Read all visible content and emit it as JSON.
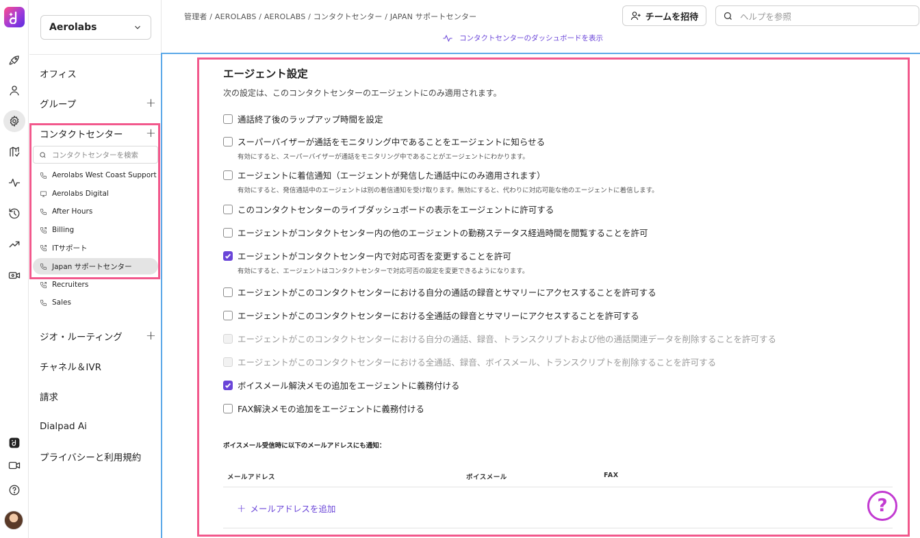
{
  "sidebar": {
    "org": "Aerolabs",
    "nav": {
      "office": "オフィス",
      "groups": "グループ",
      "contact_centers": "コンタクトセンター",
      "geo_routing": "ジオ・ルーティング",
      "channels_ivr": "チャネル＆IVR",
      "billing": "請求",
      "dialpad_ai": "Dialpad Ai",
      "privacy": "プライバシーと利用規約"
    },
    "cc_search_placeholder": "コンタクトセンターを検索",
    "contact_centers": [
      {
        "label": "Aerolabs West Coast Support",
        "icon": "phone-icon"
      },
      {
        "label": "Aerolabs Digital",
        "icon": "monitor-icon"
      },
      {
        "label": "After Hours",
        "icon": "phone-icon"
      },
      {
        "label": "Billing",
        "icon": "phone-forward-icon"
      },
      {
        "label": "ITサポート",
        "icon": "phone-forward-icon"
      },
      {
        "label": "Japan サポートセンター",
        "icon": "phone-icon",
        "selected": true
      },
      {
        "label": "Recruiters",
        "icon": "phone-forward-icon"
      },
      {
        "label": "Sales",
        "icon": "phone-icon"
      }
    ]
  },
  "header": {
    "breadcrumb": "管理者 / AEROLABS / AEROLABS / コンタクトセンター / JAPAN サポートセンター",
    "dashboard_link": "コンタクトセンターのダッシュボードを表示",
    "invite_button": "チームを招待",
    "help_search_placeholder": "ヘルプを参照"
  },
  "agent_settings": {
    "title": "エージェント設定",
    "description": "次の設定は、このコンタクトセンターのエージェントにのみ適用されます。",
    "items": [
      {
        "label": "通話終了後のラップアップ時間を設定",
        "checked": false,
        "disabled": false
      },
      {
        "label": "スーパーバイザーが通話をモニタリング中であることをエージェントに知らせる",
        "sub": "有効にすると、スーパーバイザーが通話をモニタリング中であることがエージェントにわかります。",
        "checked": false,
        "disabled": false
      },
      {
        "label": "エージェントに着信通知（エージェントが発信した通話中にのみ適用されます）",
        "sub": "有効にすると、発信通話中のエージェントは別の着信通知を受け取ります。無効にすると、代わりに対応可能な他のエージェントに着信します。",
        "checked": false,
        "disabled": false
      },
      {
        "label": "このコンタクトセンターのライブダッシュボードの表示をエージェントに許可する",
        "checked": false,
        "disabled": false
      },
      {
        "label": "エージェントがコンタクトセンター内の他のエージェントの勤務ステータス経過時間を閲覧することを許可",
        "checked": false,
        "disabled": false
      },
      {
        "label": "エージェントがコンタクトセンター内で対応可否を変更することを許可",
        "sub": "有効にすると、エージェントはコンタクトセンターで対応可否の設定を変更できるようになります。",
        "checked": true,
        "disabled": false
      },
      {
        "label": "エージェントがこのコンタクトセンターにおける自分の通話の録音とサマリーにアクセスすることを許可する",
        "checked": false,
        "disabled": false
      },
      {
        "label": "エージェントがこのコンタクトセンターにおける全通話の録音とサマリーにアクセスすることを許可する",
        "checked": false,
        "disabled": false
      },
      {
        "label": "エージェントがこのコンタクトセンターにおける自分の通話、録音、トランスクリプトおよび他の通話関連データを削除することを許可する",
        "checked": false,
        "disabled": true
      },
      {
        "label": "エージェントがこのコンタクトセンターにおける全通話、録音、ボイスメール、トランスクリプトを削除することを許可する",
        "checked": false,
        "disabled": true
      },
      {
        "label": "ボイスメール解決メモの追加をエージェントに義務付ける",
        "checked": true,
        "disabled": false
      },
      {
        "label": "FAX解決メモの追加をエージェントに義務付ける",
        "checked": false,
        "disabled": false
      }
    ]
  },
  "notify": {
    "title": "ボイスメール受信時に以下のメールアドレスにも通知：",
    "columns": [
      "メールアドレス",
      "ボイスメール",
      "FAX"
    ],
    "add_email": "メールアドレスを追加"
  },
  "help_fab": "?",
  "colors": {
    "accent": "#6a45d8",
    "highlight": "#f2588c",
    "frame": "#5aa8e8"
  }
}
